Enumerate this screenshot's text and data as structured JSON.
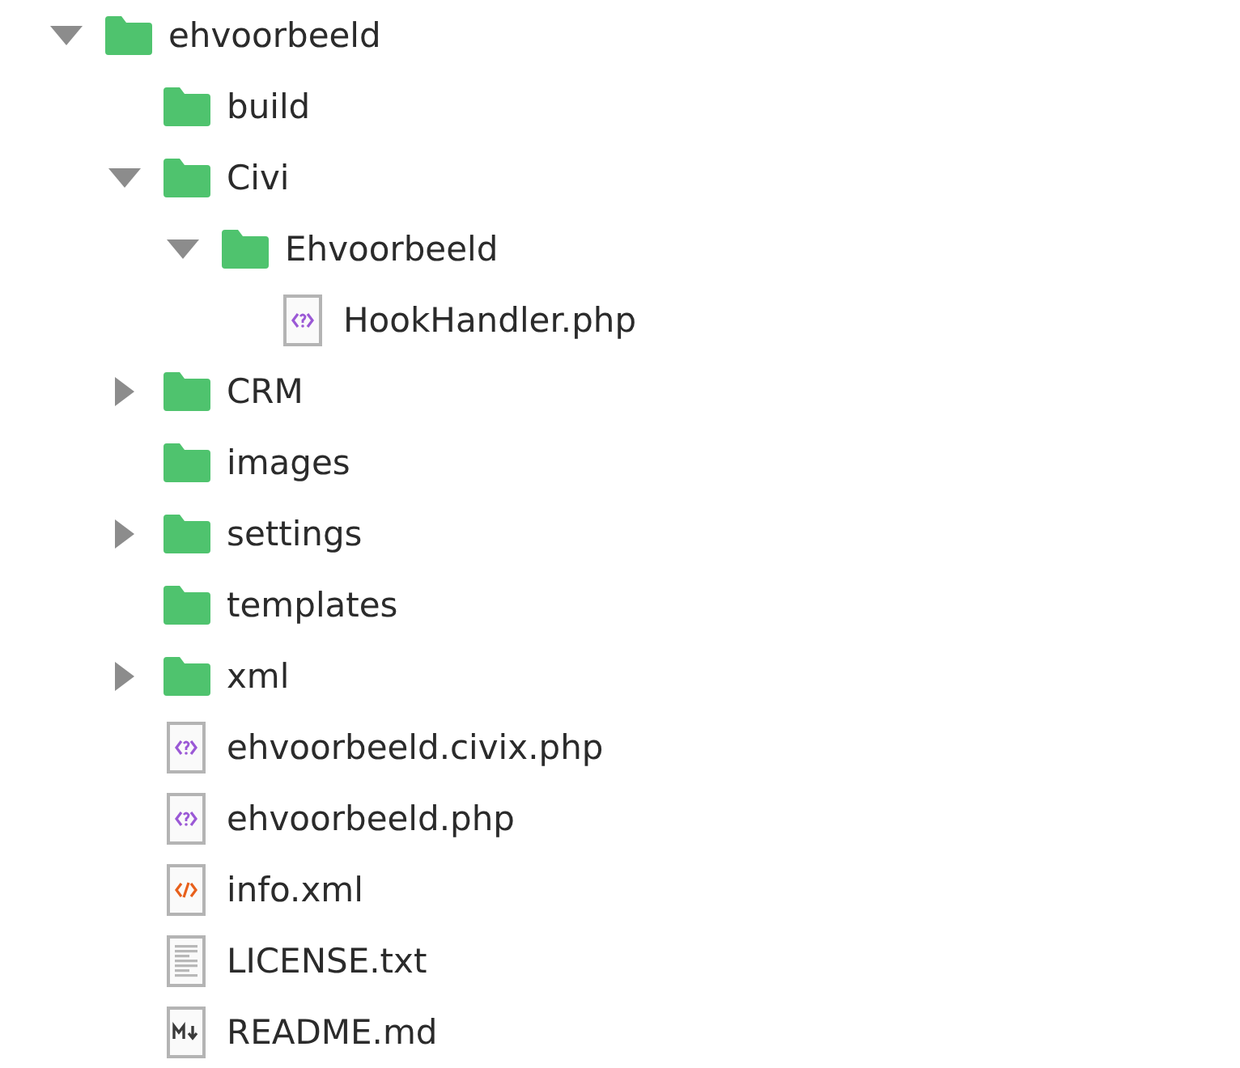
{
  "tree": [
    {
      "name": "ehvoorbeeld",
      "kind": "folder",
      "expanded": true,
      "children": [
        {
          "name": "build",
          "kind": "folder"
        },
        {
          "name": "Civi",
          "kind": "folder",
          "expanded": true,
          "children": [
            {
              "name": "Ehvoorbeeld",
              "kind": "folder",
              "expanded": true,
              "children": [
                {
                  "name": "HookHandler.php",
                  "kind": "php"
                }
              ]
            }
          ]
        },
        {
          "name": "CRM",
          "kind": "folder",
          "expanded": false
        },
        {
          "name": "images",
          "kind": "folder"
        },
        {
          "name": "settings",
          "kind": "folder",
          "expanded": false
        },
        {
          "name": "templates",
          "kind": "folder"
        },
        {
          "name": "xml",
          "kind": "folder",
          "expanded": false
        },
        {
          "name": "ehvoorbeeld.civix.php",
          "kind": "php"
        },
        {
          "name": "ehvoorbeeld.php",
          "kind": "php"
        },
        {
          "name": "info.xml",
          "kind": "xml"
        },
        {
          "name": "LICENSE.txt",
          "kind": "text"
        },
        {
          "name": "README.md",
          "kind": "markdown"
        }
      ]
    }
  ]
}
